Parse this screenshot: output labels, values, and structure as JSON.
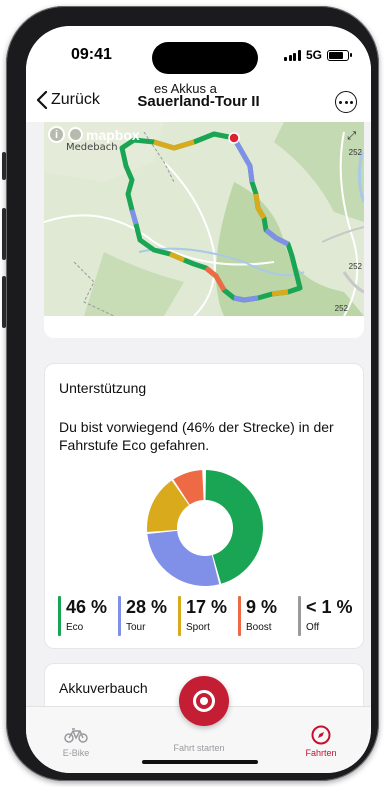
{
  "status": {
    "time": "09:41",
    "network": "5G"
  },
  "nav": {
    "back_label": "Zurück",
    "title": "Sauerland-Tour II"
  },
  "map": {
    "attribution": "mapbox",
    "town": "Medebach",
    "road_labels": [
      "252",
      "252",
      "252"
    ]
  },
  "support": {
    "title": "Unterstützung",
    "description": "Du bist vorwiegend (46% der Strecke) in der Fahrstufe Eco gefahren.",
    "levels": [
      {
        "label": "Eco",
        "value_text": "46 %",
        "share": 46,
        "color": "#1aa555"
      },
      {
        "label": "Tour",
        "value_text": "28 %",
        "share": 28,
        "color": "#8090e8"
      },
      {
        "label": "Sport",
        "value_text": "17 %",
        "share": 17,
        "color": "#d8aa1c"
      },
      {
        "label": "Boost",
        "value_text": "9 %",
        "share": 9,
        "color": "#ee6a45"
      },
      {
        "label": "Off",
        "value_text": "< 1 %",
        "share": 0.5,
        "color": "#9a9a9a"
      }
    ]
  },
  "battery_card": {
    "title": "Akkuverbauch",
    "subtitle_partial": "es Akkus a"
  },
  "tabs": [
    {
      "label": "E-Bike",
      "icon": "bike-icon",
      "active": false
    },
    {
      "label": "Fahrt starten",
      "icon": "record-icon",
      "active": false
    },
    {
      "label": "Fahrten",
      "icon": "compass-icon",
      "active": true
    }
  ]
}
